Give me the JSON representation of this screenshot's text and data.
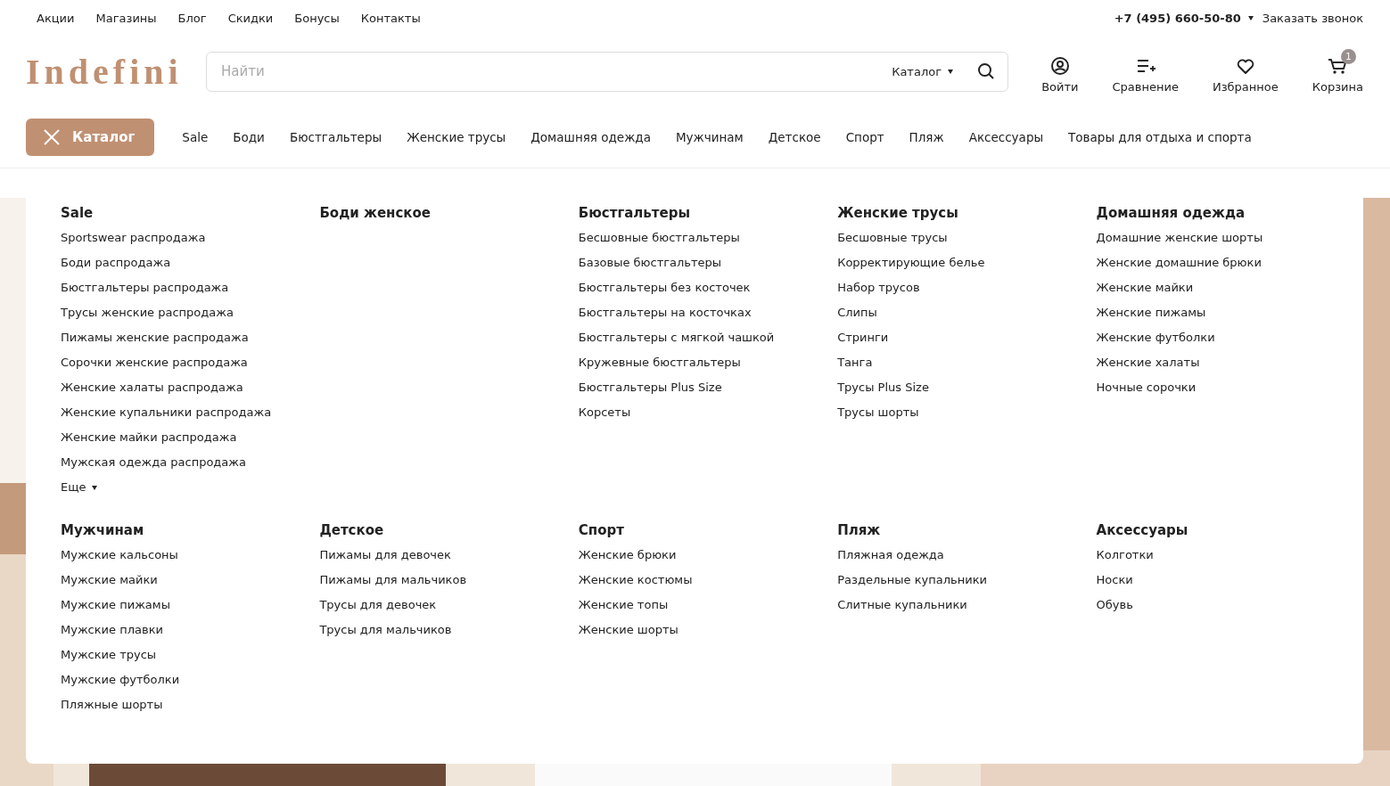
{
  "top_links": [
    "Акции",
    "Магазины",
    "Блог",
    "Скидки",
    "Бонусы",
    "Контакты"
  ],
  "phone": "+7 (495) 660-50-80",
  "callback": "Заказать звонок",
  "logo": "Indefini",
  "search": {
    "placeholder": "Найти",
    "scope": "Каталог"
  },
  "actions": [
    {
      "kind": "user",
      "label": "Войти"
    },
    {
      "kind": "compare",
      "label": "Сравнение"
    },
    {
      "kind": "heart",
      "label": "Избранное"
    },
    {
      "kind": "cart",
      "label": "Корзина",
      "badge": "1"
    }
  ],
  "catalog_button": {
    "label": "Каталог",
    "expanded": true
  },
  "nav": [
    "Sale",
    "Боди",
    "Бюстгальтеры",
    "Женские трусы",
    "Домашняя одежда",
    "Мужчинам",
    "Детское",
    "Спорт",
    "Пляж",
    "Аксессуары",
    "Товары для отдыха и спорта"
  ],
  "menu": [
    {
      "title": "Sale",
      "items": [
        "Sportswear распродажа",
        "Боди распродажа",
        "Бюстгальтеры распродажа",
        "Трусы женские распродажа",
        "Пижамы женские распродажа",
        "Сорочки женские распродажа",
        "Женские халаты распродажа",
        "Женские купальники распродажа",
        "Женские майки распродажа",
        "Мужская одежда распродажа"
      ],
      "more": "Еще"
    },
    {
      "title": "Боди женское"
    },
    {
      "title": "Бюстгальтеры",
      "items": [
        "Бесшовные бюстгальтеры",
        "Базовые бюстгальтеры",
        "Бюстгальтеры без косточек",
        "Бюстгальтеры на косточках",
        "Бюстгальтеры с мягкой чашкой",
        "Кружевные бюстгальтеры",
        "Бюстгальтеры Plus Size",
        "Корсеты"
      ]
    },
    {
      "title": "Женские трусы",
      "items": [
        "Бесшовные трусы",
        "Корректирующие белье",
        "Набор трусов",
        "Слипы",
        "Стринги",
        "Танга",
        "Трусы Plus Size",
        "Трусы шорты"
      ]
    },
    {
      "title": "Домашняя одежда",
      "items": [
        "Домашние женские шорты",
        "Женские домашние брюки",
        "Женские майки",
        "Женские пижамы",
        "Женские футболки",
        "Женские халаты",
        "Ночные сорочки"
      ]
    },
    {
      "title": "Мужчинам",
      "items": [
        "Мужские кальсоны",
        "Мужские майки",
        "Мужские пижамы",
        "Мужские плавки",
        "Мужские трусы",
        "Мужские футболки",
        "Пляжные шорты"
      ]
    },
    {
      "title": "Детское",
      "items": [
        "Пижамы для девочек",
        "Пижамы для мальчиков",
        "Трусы для девочек",
        "Трусы для мальчиков"
      ]
    },
    {
      "title": "Спорт",
      "items": [
        "Женские брюки",
        "Женские костюмы",
        "Женские топы",
        "Женские шорты"
      ]
    },
    {
      "title": "Пляж",
      "items": [
        "Пляжная одежда",
        "Раздельные купальники",
        "Слитные купальники"
      ]
    },
    {
      "title": "Аксессуары",
      "items": [
        "Колготки",
        "Носки",
        "Обувь"
      ]
    }
  ]
}
